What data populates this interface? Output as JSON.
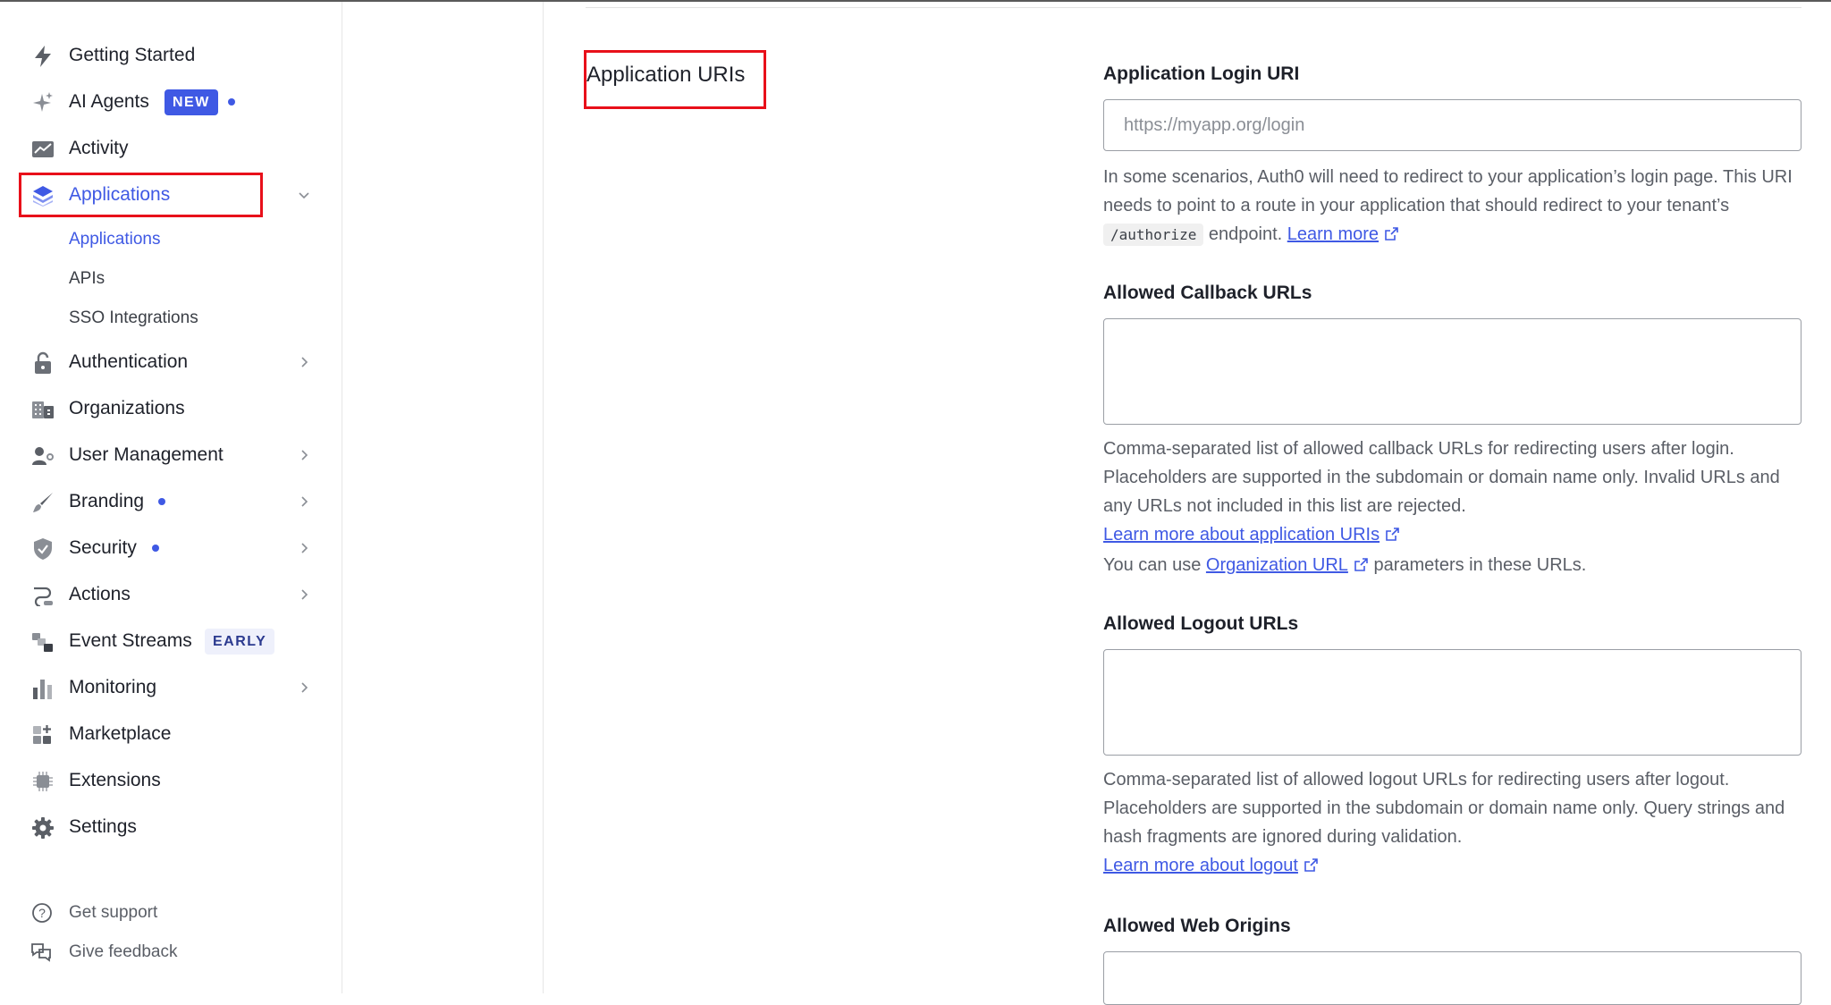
{
  "sidebar": {
    "items": [
      {
        "label": "Getting Started"
      },
      {
        "label": "AI Agents",
        "badge": "NEW"
      },
      {
        "label": "Activity"
      },
      {
        "label": "Applications"
      },
      {
        "label": "Authentication"
      },
      {
        "label": "Organizations"
      },
      {
        "label": "User Management"
      },
      {
        "label": "Branding"
      },
      {
        "label": "Security"
      },
      {
        "label": "Actions"
      },
      {
        "label": "Event Streams",
        "badge": "EARLY"
      },
      {
        "label": "Monitoring"
      },
      {
        "label": "Marketplace"
      },
      {
        "label": "Extensions"
      },
      {
        "label": "Settings"
      }
    ],
    "sub_items": [
      {
        "label": "Applications"
      },
      {
        "label": "APIs"
      },
      {
        "label": "SSO Integrations"
      }
    ],
    "footer": [
      {
        "label": "Get support"
      },
      {
        "label": "Give feedback"
      }
    ]
  },
  "section": {
    "title": "Application URIs"
  },
  "fields": {
    "login_uri": {
      "label": "Application Login URI",
      "placeholder": "https://myapp.org/login",
      "help_before": "In some scenarios, Auth0 will need to redirect to your application’s login page. This URI needs to point to a route in your application that should redirect to your tenant’s",
      "help_code": "/authorize",
      "help_after": "endpoint.",
      "help_link": "Learn more"
    },
    "callback_urls": {
      "label": "Allowed Callback URLs",
      "help": "Comma-separated list of allowed callback URLs for redirecting users after login. Placeholders are supported in the subdomain or domain name only. Invalid URLs and any URLs not included in this list are rejected.",
      "link1": "Learn more about application URIs",
      "org_before": "You can use",
      "org_link": "Organization URL",
      "org_after": "parameters in these URLs."
    },
    "logout_urls": {
      "label": "Allowed Logout URLs",
      "help": "Comma-separated list of allowed logout URLs for redirecting users after logout. Placeholders are supported in the subdomain or domain name only. Query strings and hash fragments are ignored during validation.",
      "link": "Learn more about logout"
    },
    "web_origins": {
      "label": "Allowed Web Origins"
    }
  },
  "colors": {
    "accent": "#3f59e4",
    "highlight": "#e8101a"
  }
}
